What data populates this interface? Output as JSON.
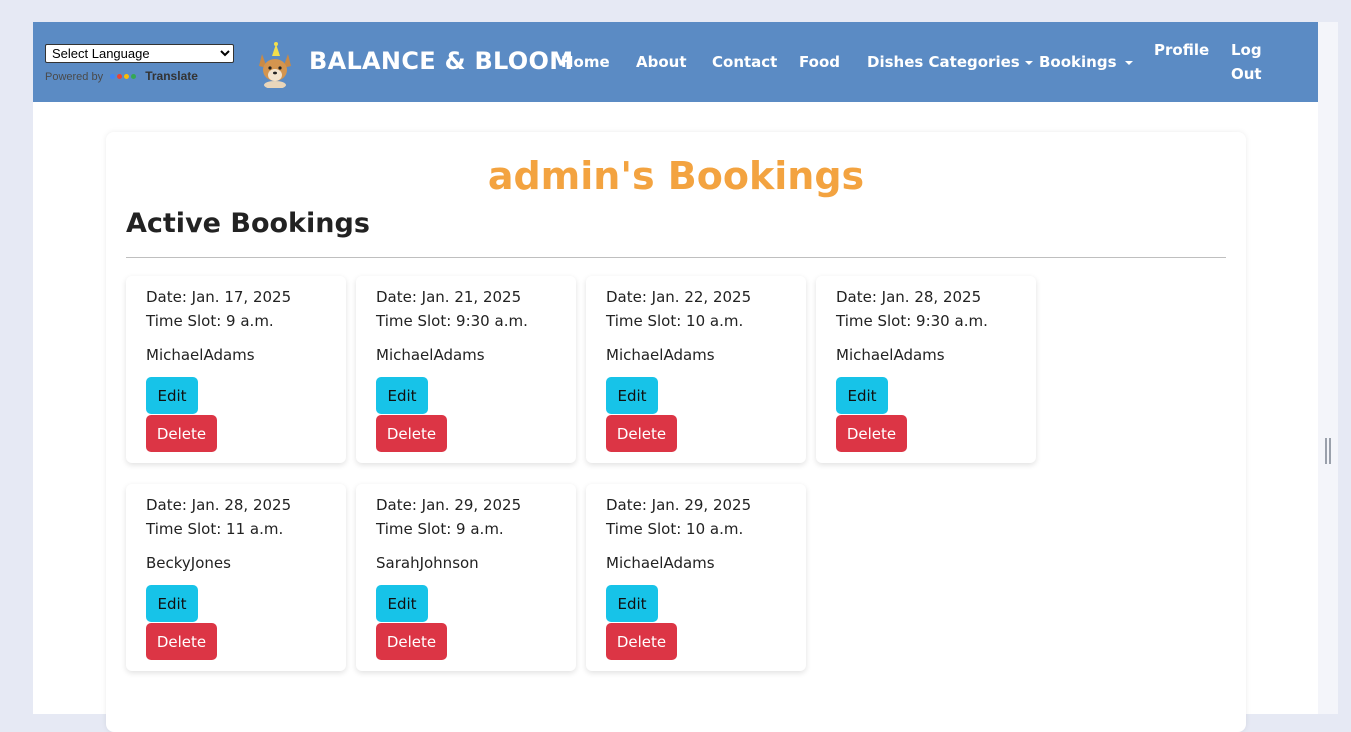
{
  "translate": {
    "select_label": "Select Language",
    "powered_by": "Powered by",
    "translate_label": "Translate"
  },
  "brand": {
    "name": "BALANCE & BLOOM"
  },
  "nav": {
    "home": "Home",
    "about": "About",
    "contact": "Contact",
    "food": "Food",
    "dishes": "Dishes Categories",
    "bookings": "Bookings",
    "profile": "Profile",
    "logout_line1": "Log",
    "logout_line2": "Out"
  },
  "page": {
    "title": "admin's Bookings",
    "section": "Active Bookings"
  },
  "bookings": [
    {
      "date": "Date: Jan. 17, 2025",
      "slot": "Time Slot: 9 a.m.",
      "user": "MichaelAdams",
      "edit": "Edit",
      "delete": "Delete"
    },
    {
      "date": "Date: Jan. 21, 2025",
      "slot": "Time Slot: 9:30 a.m.",
      "user": "MichaelAdams",
      "edit": "Edit",
      "delete": "Delete"
    },
    {
      "date": "Date: Jan. 22, 2025",
      "slot": "Time Slot: 10 a.m.",
      "user": "MichaelAdams",
      "edit": "Edit",
      "delete": "Delete"
    },
    {
      "date": "Date: Jan. 28, 2025",
      "slot": "Time Slot: 9:30 a.m.",
      "user": "MichaelAdams",
      "edit": "Edit",
      "delete": "Delete"
    },
    {
      "date": "Date: Jan. 28, 2025",
      "slot": "Time Slot: 11 a.m.",
      "user": "BeckyJones",
      "edit": "Edit",
      "delete": "Delete"
    },
    {
      "date": "Date: Jan. 29, 2025",
      "slot": "Time Slot: 9 a.m.",
      "user": "SarahJohnson",
      "edit": "Edit",
      "delete": "Delete"
    },
    {
      "date": "Date: Jan. 29, 2025",
      "slot": "Time Slot: 10 a.m.",
      "user": "MichaelAdams",
      "edit": "Edit",
      "delete": "Delete"
    }
  ],
  "colors": {
    "navbar": "#5b8bc4",
    "title": "#f3a340",
    "edit_button": "#17c3e8",
    "delete_button": "#dc3545"
  }
}
